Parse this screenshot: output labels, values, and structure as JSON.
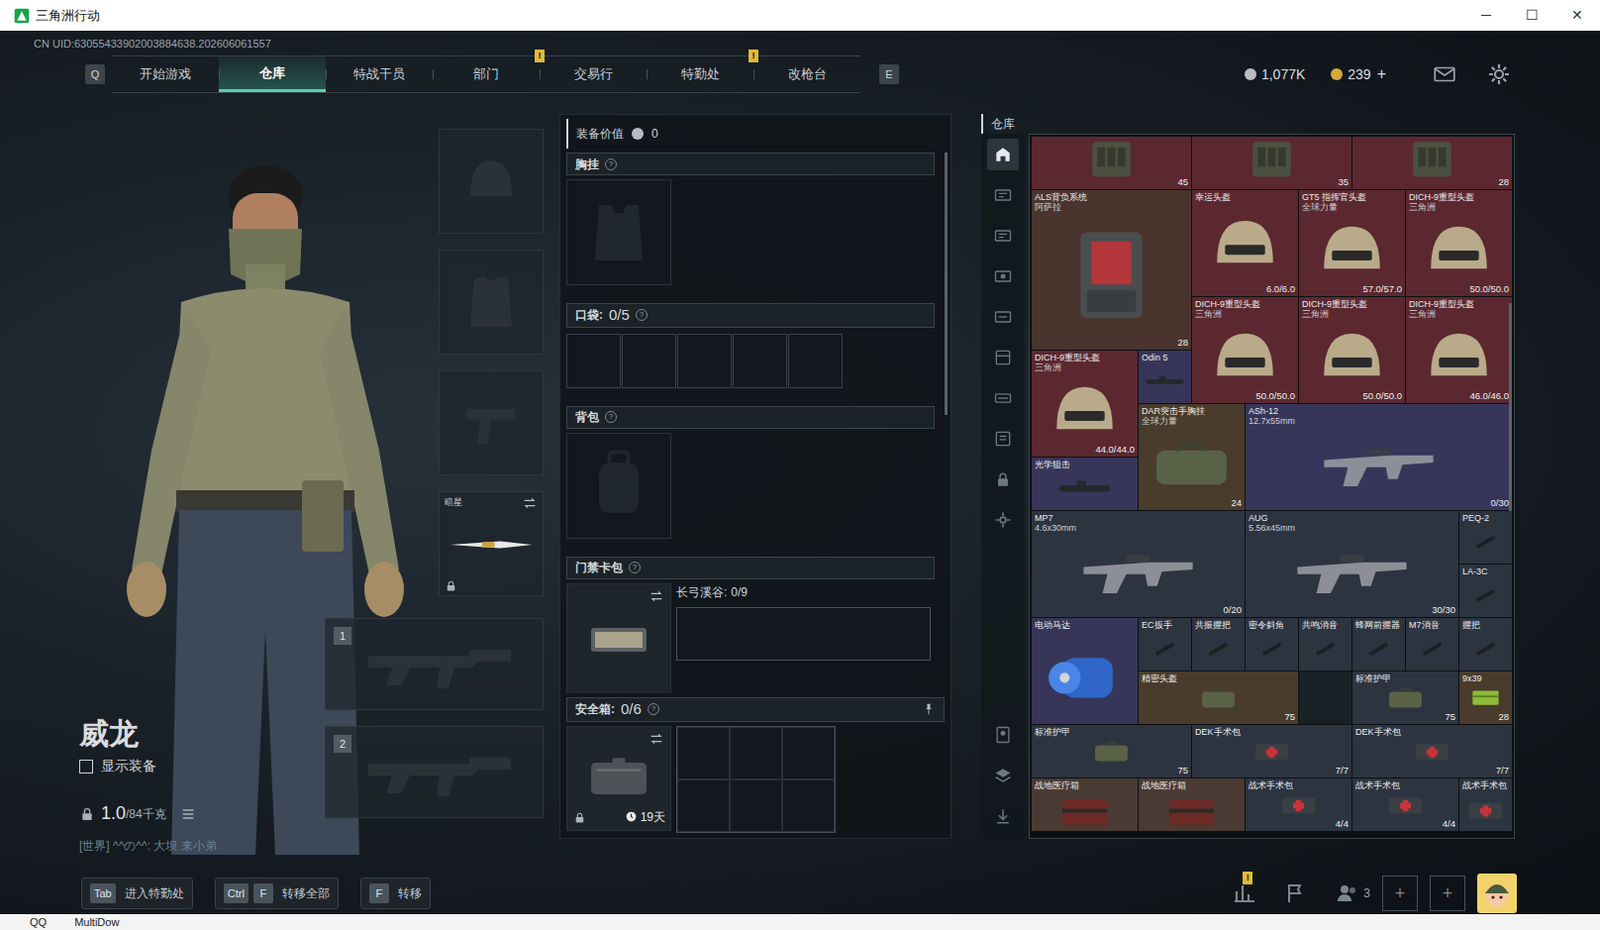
{
  "window": {
    "title": "三角洲行动",
    "controls": [
      "─",
      "☐",
      "✕"
    ]
  },
  "uid": "CN UID:63055433902003884638.202606061557",
  "nav": {
    "prev_key": "Q",
    "next_key": "E",
    "alert_mark": "!",
    "tabs": [
      {
        "label": "开始游戏",
        "selected": false,
        "alert": false
      },
      {
        "label": "仓库",
        "selected": true,
        "alert": false
      },
      {
        "label": "特战干员",
        "selected": false,
        "alert": false
      },
      {
        "label": "部门",
        "selected": false,
        "alert": true
      },
      {
        "label": "交易行",
        "selected": false,
        "alert": false
      },
      {
        "label": "特勤处",
        "selected": false,
        "alert": true
      },
      {
        "label": "改枪台",
        "selected": false,
        "alert": false
      }
    ]
  },
  "currencies": [
    {
      "amount": "1,077K",
      "color": "#b8bcc0"
    },
    {
      "amount": "239",
      "add": "+",
      "color": "#d8a93a"
    }
  ],
  "character": {
    "name": "威龙",
    "show_equipment": {
      "label": "显示装备",
      "checked": false
    },
    "weight": "1.0",
    "weight_max": "/84千克",
    "chat": "[世界] ^^の^^: 大坝 来小弟"
  },
  "slots": {
    "melee": {
      "label": "暗星",
      "locked": true
    },
    "guns": [
      {
        "number": "1"
      },
      {
        "number": "2"
      }
    ]
  },
  "loadout": {
    "value_label": "装备价值",
    "value": "0",
    "help_mark": "?",
    "chest": {
      "label": "胸挂"
    },
    "pockets": {
      "label": "口袋:",
      "count": "0/5",
      "slots": [
        {
          "filled": false
        },
        {
          "filled": false
        },
        {
          "filled": false
        },
        {
          "filled": false
        },
        {
          "filled": false
        }
      ]
    },
    "backpack": {
      "label": "背包"
    },
    "keycard": {
      "label": "门禁卡包",
      "map": "长弓溪谷:",
      "count": "0/9"
    },
    "safe": {
      "label": "安全箱:",
      "count": "0/6",
      "timer": "19天",
      "locked": true,
      "slots": [
        {
          "filled": false
        },
        {
          "filled": false
        },
        {
          "filled": false
        },
        {
          "filled": false
        },
        {
          "filled": false
        },
        {
          "filled": false
        }
      ]
    }
  },
  "warehouse": {
    "title": "仓库",
    "sidebar": [
      {
        "selected": true
      },
      {
        "selected": false
      },
      {
        "selected": false
      },
      {
        "selected": false
      },
      {
        "selected": false
      },
      {
        "selected": false
      },
      {
        "selected": false
      },
      {
        "selected": false
      },
      {
        "selected": false
      },
      {
        "selected": false
      },
      {
        "selected": false
      },
      {
        "selected": false
      },
      {
        "selected": false
      }
    ],
    "items": [
      {
        "value": "45",
        "kind": "vest",
        "color": "#5b2830"
      },
      {
        "value": "35",
        "kind": "vest",
        "color": "#5b2830"
      },
      {
        "value": "28",
        "kind": "vest",
        "color": "#5b2830"
      },
      {
        "name": "ALS背负系统",
        "sub": "阿萨拉",
        "value": "28",
        "kind": "rig",
        "color": "#4a352e"
      },
      {
        "name": "幸运头盔",
        "value": "6.0/6.0",
        "kind": "helmet",
        "color": "#5b2830"
      },
      {
        "name": "GT5 指挥官头盔",
        "sub": "全球力量",
        "value": "57.0/57.0",
        "kind": "helmet",
        "color": "#5b2830"
      },
      {
        "name": "DICH-9重型头盔",
        "sub": "三角洲",
        "value": "50.0/50.0",
        "kind": "helmet",
        "color": "#5b2830"
      },
      {
        "name": "DICH-9重型头盔",
        "sub": "三角洲",
        "value": "50.0/50.0",
        "kind": "helmet",
        "color": "#5b2830"
      },
      {
        "name": "DICH-9重型头盔",
        "sub": "三角洲",
        "value": "50.0/50.0",
        "kind": "helmet",
        "color": "#5b2830"
      },
      {
        "name": "DICH-9重型头盔",
        "sub": "三角洲",
        "value": "46.0/46.0",
        "kind": "helmet",
        "color": "#5b2830"
      },
      {
        "name": "DICH-9重型头盔",
        "sub": "三角洲",
        "value": "44.0/44.0",
        "kind": "helmet",
        "color": "#5b2830"
      },
      {
        "name": "Odin 5",
        "kind": "scope",
        "color": "#37365a"
      },
      {
        "name": "DAR突击手胸挂",
        "sub": "全球力量",
        "value": "24",
        "kind": "bag",
        "color": "#4a3c2c"
      },
      {
        "name": "ASh-12",
        "sub": "12.7x55mm",
        "value": "0/30",
        "kind": "rifle",
        "color": "#37365a"
      },
      {
        "name": "光学狙击",
        "kind": "scope",
        "color": "#37365a"
      },
      {
        "name": "MP7",
        "sub": "4.6x30mm",
        "value": "0/20",
        "kind": "rifle",
        "color": "#2c3440"
      },
      {
        "name": "AUG",
        "sub": "5.56x45mm",
        "value": "30/30",
        "kind": "rifle",
        "color": "#2c3440"
      },
      {
        "name": "PEQ-2",
        "kind": "attachment",
        "color": "#2c3440"
      },
      {
        "name": "LA-3C",
        "kind": "attachment",
        "color": "#2c3440"
      },
      {
        "name": "电动马达",
        "kind": "motor",
        "color": "#37365a"
      },
      {
        "name": "EC扳手",
        "kind": "attachment",
        "color": "#2c3440"
      },
      {
        "name": "共振握把",
        "kind": "attachment",
        "color": "#2c3440"
      },
      {
        "name": "密令斜角",
        "kind": "attachment",
        "color": "#2c3440"
      },
      {
        "name": "共鸣消音",
        "kind": "attachment",
        "color": "#2c3440"
      },
      {
        "name": "蜂网前握器",
        "kind": "attachment",
        "color": "#2c3440"
      },
      {
        "name": "M7消音",
        "kind": "attachment",
        "color": "#2c3440"
      },
      {
        "name": "握把",
        "kind": "attachment",
        "color": "#2c3440"
      },
      {
        "name": "精密头盔",
        "value": "75",
        "kind": "bag",
        "color": "#4a3c2c"
      },
      {
        "name": "标准护甲",
        "value": "75",
        "kind": "bag",
        "color": "#2c3440"
      },
      {
        "name": "9x39",
        "value": "28",
        "kind": "ammo",
        "color": "#4a3c2c"
      },
      {
        "name": "标准护甲",
        "value": "75",
        "kind": "bag",
        "color": "#2c3440"
      },
      {
        "name": "DEK手术包",
        "value": "7/7",
        "kind": "medkit",
        "color": "#2c3440"
      },
      {
        "name": "DEK手术包",
        "value": "7/7",
        "kind": "medkit",
        "color": "#2c3440"
      },
      {
        "name": "战地医疗箱",
        "kind": "medbox",
        "color": "#4a3a34"
      },
      {
        "name": "战地医疗箱",
        "kind": "medbox",
        "color": "#4a3a34"
      },
      {
        "name": "战术手术包",
        "value": "4/4",
        "kind": "medkit",
        "color": "#2c3440"
      },
      {
        "name": "战术手术包",
        "value": "4/4",
        "kind": "medkit",
        "color": "#2c3440"
      },
      {
        "name": "战术手术包",
        "kind": "medkit",
        "color": "#2c3440"
      }
    ]
  },
  "bottom_bar": {
    "actions": [
      {
        "keys": [
          "Tab"
        ],
        "label": "进入特勤处"
      },
      {
        "keys": [
          "Ctrl",
          "F"
        ],
        "label": "转移全部"
      },
      {
        "keys": [
          "F"
        ],
        "label": "转移"
      }
    ],
    "alert_mark": "!",
    "friends": "3",
    "party_slots": [
      {
        "label": "+"
      },
      {
        "label": "+"
      }
    ]
  },
  "taskbar": [
    "QQ",
    "MultiDow"
  ]
}
